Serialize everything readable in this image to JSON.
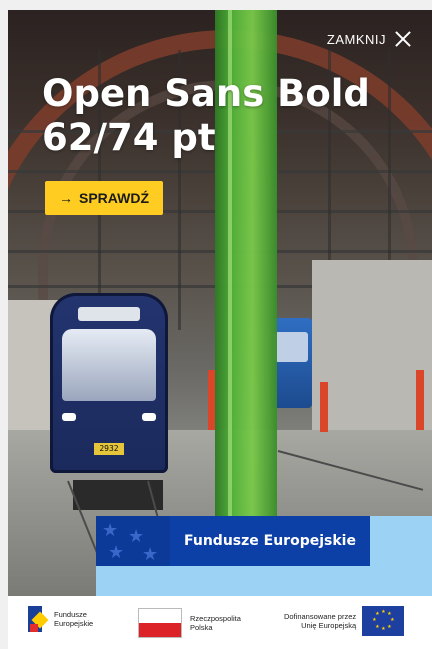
{
  "close": {
    "label": "ZAMKNIJ"
  },
  "headline": {
    "line1": "Open Sans Bold",
    "line2": "62/74 pt"
  },
  "cta": {
    "label": "SPRAWDŹ",
    "icon": "arrow-right-icon"
  },
  "tram": {
    "number": "2932"
  },
  "banner": {
    "text": "Fundusze Europejskie"
  },
  "footer": {
    "fe_logo": {
      "line1": "Fundusze",
      "line2": "Europejskie"
    },
    "rp_logo": {
      "line1": "Rzeczpospolita",
      "line2": "Polska"
    },
    "eu_logo": {
      "line1": "Dofinansowane przez",
      "line2": "Unię Europejską"
    }
  },
  "colors": {
    "accent_yellow": "#ffcc21",
    "eu_blue": "#0d40a6",
    "banner_light_blue": "#9cd3f5"
  }
}
